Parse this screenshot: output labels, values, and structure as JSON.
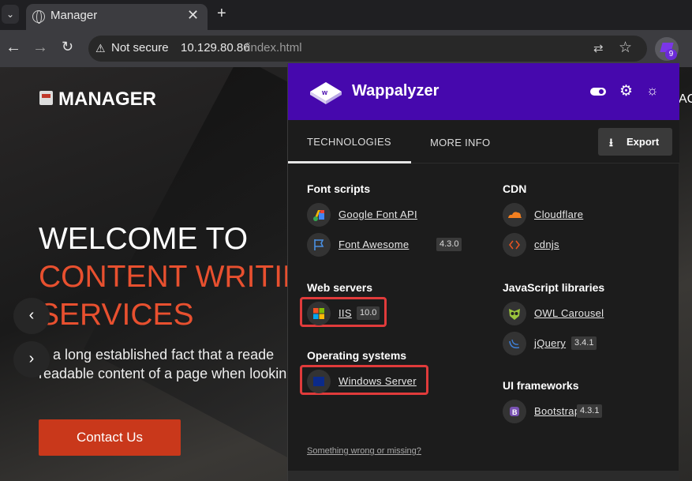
{
  "browser": {
    "tab_title": "Manager",
    "tab_close": "✕",
    "new_tab": "+",
    "tab_menu": "⌄",
    "security_label": "Not secure",
    "url_host": "10.129.80.86",
    "url_path": "/index.html",
    "extension_badge": "9"
  },
  "website": {
    "logo_text": "MANAGER",
    "hero_line1": "WELCOME TO",
    "hero_line2": "CONTENT WRITIN",
    "hero_line3": "SERVICES",
    "paragraph_line1": "is a long established fact that a reade",
    "paragraph_line2": "readable content of a page when lookin",
    "contact_label": "Contact Us",
    "right_edge_text": "AC",
    "prev_arrow": "‹",
    "next_arrow": "›"
  },
  "wappalyzer": {
    "brand": "Wappalyzer",
    "brand_color": "#4608ad",
    "tabs": [
      {
        "label": "TECHNOLOGIES",
        "active": true
      },
      {
        "label": "MORE INFO",
        "active": false
      }
    ],
    "export_label": "Export",
    "categories": {
      "font_scripts": "Font scripts",
      "cdn": "CDN",
      "web_servers": "Web servers",
      "javascript_libraries": "JavaScript libraries",
      "operating_systems": "Operating systems",
      "ui_frameworks": "UI frameworks"
    },
    "technologies": {
      "google_font_api": {
        "name": "Google Font API",
        "version": ""
      },
      "font_awesome": {
        "name": "Font Awesome",
        "version": "4.3.0"
      },
      "cloudflare": {
        "name": "Cloudflare",
        "version": ""
      },
      "cdnjs": {
        "name": "cdnjs",
        "version": ""
      },
      "iis": {
        "name": "IIS",
        "version": "10.0"
      },
      "owl_carousel": {
        "name": "OWL Carousel",
        "version": ""
      },
      "jquery": {
        "name": "jQuery",
        "version": "3.4.1"
      },
      "windows_server": {
        "name": "Windows Server",
        "version": ""
      },
      "bootstrap": {
        "name": "Bootstrap",
        "version": "4.3.1"
      }
    },
    "highlighted": [
      "IIS",
      "Windows Server"
    ],
    "highlight_color": "#e03b3b",
    "footer_link": "Something wrong or missing?"
  }
}
